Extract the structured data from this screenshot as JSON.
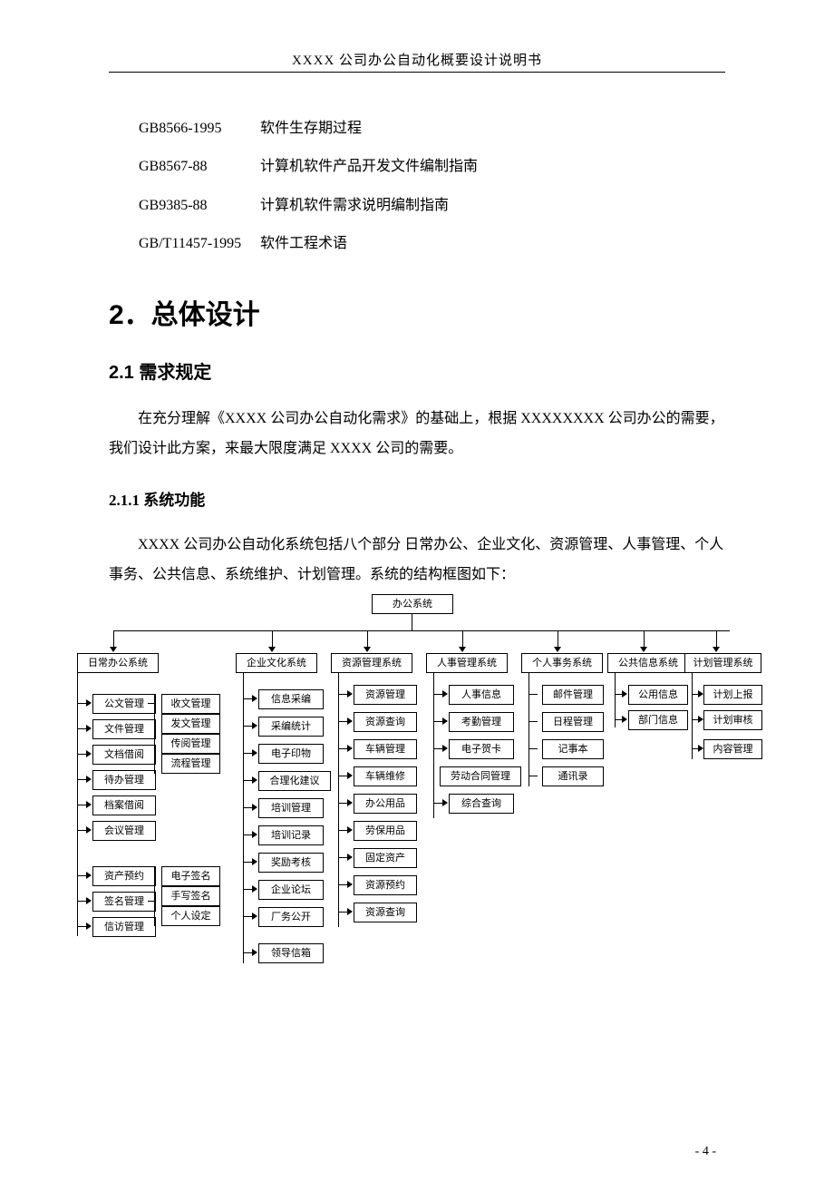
{
  "header": {
    "running": "XXXX 公司办公自动化概要设计说明书"
  },
  "references": [
    {
      "code": "GB8566-1995",
      "title": "软件生存期过程"
    },
    {
      "code": "GB8567-88",
      "title": "计算机软件产品开发文件编制指南"
    },
    {
      "code": "GB9385-88",
      "title": "计算机软件需求说明编制指南"
    },
    {
      "code": "GB/T11457-1995",
      "title": "软件工程术语"
    }
  ],
  "h1": "2．总体设计",
  "h2": "2.1 需求规定",
  "p1": "在充分理解《XXXX 公司办公自动化需求》的基础上，根据 XXXXXXXX 公司办公的需要，我们设计此方案，来最大限度满足 XXXX 公司的需要。",
  "h3": "2.1.1 系统功能",
  "p2": "XXXX 公司办公自动化系统包括八个部分 日常办公、企业文化、资源管理、人事管理、个人事务、公共信息、系统维护、计划管理。系统的结构框图如下：",
  "diagram": {
    "root": "办公系统",
    "systems": [
      "日常办公系统",
      "企业文化系统",
      "资源管理系统",
      "人事管理系统",
      "个人事务系统",
      "公共信息系统",
      "计划管理系统"
    ],
    "daily": [
      "公文管理",
      "文件管理",
      "文档借阅",
      "待办管理",
      "档案借阅",
      "会议管理",
      "资产预约",
      "签名管理",
      "信访管理"
    ],
    "daily_right": [
      "收文管理",
      "发文管理",
      "传阅管理",
      "流程管理",
      "电子签名",
      "手写签名",
      "个人设定"
    ],
    "culture": [
      "信息采编",
      "采编统计",
      "电子印物",
      "合理化建议",
      "培训管理",
      "培训记录",
      "奖励考核",
      "企业论坛",
      "厂务公开",
      "领导信箱"
    ],
    "resource": [
      "资源管理",
      "资源查询",
      "车辆管理",
      "车辆维修",
      "办公用品",
      "劳保用品",
      "固定资产",
      "资源预约",
      "资源查询"
    ],
    "hr": [
      "人事信息",
      "考勤管理",
      "电子贺卡",
      "劳动合同管理",
      "综合查询"
    ],
    "personal": [
      "邮件管理",
      "日程管理",
      "记事本",
      "通讯录"
    ],
    "public": [
      "公用信息",
      "部门信息"
    ],
    "plan": [
      "计划上报",
      "计划审核",
      "内容管理"
    ]
  },
  "pagenum": "- 4 -"
}
